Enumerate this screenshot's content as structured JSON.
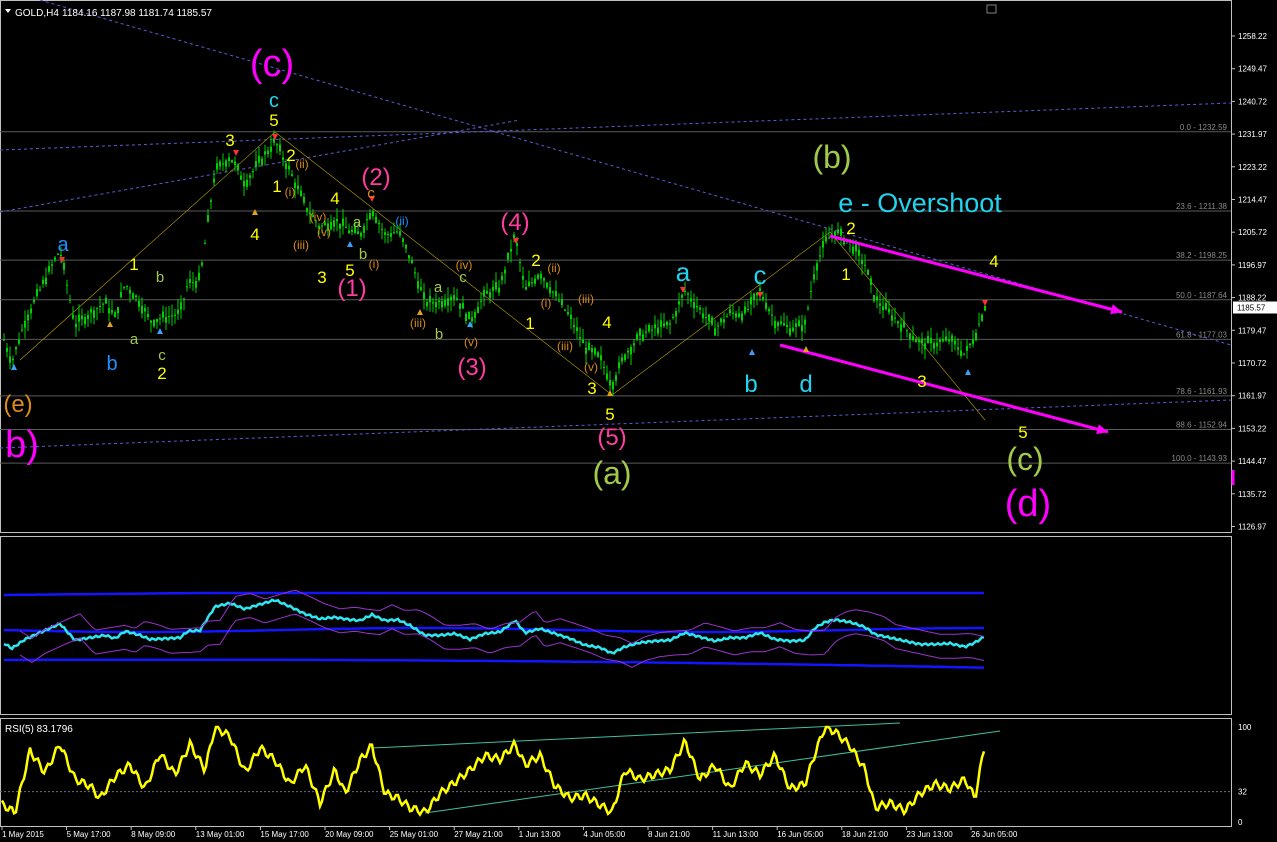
{
  "header": {
    "symbol": "GOLD,H4",
    "ohlc": "1184.16 1187.98 1181.74 1185.57"
  },
  "colors": {
    "candle": "#00d000",
    "magenta": "#ff00ff",
    "cyan": "#22d3ee",
    "blue": "#1e90ff",
    "yellow": "#ffff00",
    "olive": "#a3c94a",
    "orange": "#d98a1c",
    "red": "#ff2a2a",
    "pink": "#ff3ca0",
    "fib": "#8a8a8a",
    "channel": "#1414ff"
  },
  "chart_data": [
    {
      "type": "line",
      "panel": "price",
      "title": "",
      "ylim": [
        1122,
        1265
      ],
      "y_ticks": [
        "1258.22",
        "1249.47",
        "1240.72",
        "1231.97",
        "1223.22",
        "1214.47",
        "1205.72",
        "1196.97",
        "1188.22",
        "1179.47",
        "1170.72",
        "1161.97",
        "1153.22",
        "1144.47",
        "1135.72",
        "1126.97"
      ],
      "current_price": "1185.57",
      "x_ticks": [
        "1 May 2015",
        "5 May 17:00",
        "8 May 09:00",
        "13 May 01:00",
        "15 May 17:00",
        "20 May 09:00",
        "25 May 01:00",
        "27 May 21:00",
        "1 Jun 13:00",
        "4 Jun 05:00",
        "8 Jun 21:00",
        "11 Jun 13:00",
        "16 Jun 05:00",
        "18 Jun 21:00",
        "23 Jun 13:00",
        "26 Jun 05:00"
      ],
      "close_anchors": [
        [
          0,
          1180
        ],
        [
          12,
          1171
        ],
        [
          25,
          1182
        ],
        [
          45,
          1193
        ],
        [
          60,
          1201
        ],
        [
          75,
          1181
        ],
        [
          90,
          1184
        ],
        [
          105,
          1187
        ],
        [
          115,
          1183
        ],
        [
          125,
          1192
        ],
        [
          140,
          1187
        ],
        [
          150,
          1182
        ],
        [
          165,
          1183
        ],
        [
          180,
          1184
        ],
        [
          188,
          1192
        ],
        [
          200,
          1193
        ],
        [
          215,
          1222
        ],
        [
          230,
          1226
        ],
        [
          245,
          1219
        ],
        [
          258,
          1224
        ],
        [
          275,
          1230
        ],
        [
          290,
          1222
        ],
        [
          305,
          1213
        ],
        [
          320,
          1207
        ],
        [
          335,
          1209
        ],
        [
          350,
          1206
        ],
        [
          360,
          1205
        ],
        [
          372,
          1212
        ],
        [
          385,
          1205
        ],
        [
          398,
          1206
        ],
        [
          410,
          1199
        ],
        [
          425,
          1187
        ],
        [
          440,
          1187
        ],
        [
          455,
          1189
        ],
        [
          470,
          1182
        ],
        [
          485,
          1189
        ],
        [
          500,
          1191
        ],
        [
          515,
          1205
        ],
        [
          525,
          1190
        ],
        [
          540,
          1195
        ],
        [
          555,
          1189
        ],
        [
          570,
          1183
        ],
        [
          585,
          1175
        ],
        [
          600,
          1172
        ],
        [
          612,
          1165
        ],
        [
          625,
          1173
        ],
        [
          640,
          1178
        ],
        [
          655,
          1180
        ],
        [
          670,
          1181
        ],
        [
          685,
          1190
        ],
        [
          700,
          1185
        ],
        [
          715,
          1180
        ],
        [
          730,
          1184
        ],
        [
          745,
          1184
        ],
        [
          760,
          1190
        ],
        [
          775,
          1182
        ],
        [
          790,
          1180
        ],
        [
          805,
          1181
        ],
        [
          815,
          1196
        ],
        [
          825,
          1203
        ],
        [
          835,
          1206
        ],
        [
          850,
          1203
        ],
        [
          865,
          1197
        ],
        [
          875,
          1188
        ],
        [
          890,
          1184
        ],
        [
          905,
          1180
        ],
        [
          920,
          1176
        ],
        [
          935,
          1176
        ],
        [
          950,
          1177
        ],
        [
          965,
          1173
        ],
        [
          975,
          1178
        ],
        [
          985,
          1186
        ]
      ],
      "fibonacci": [
        {
          "level": "0.0",
          "price": 1232.59
        },
        {
          "level": "23.6",
          "price": 1211.38
        },
        {
          "level": "38.2",
          "price": 1198.25
        },
        {
          "level": "50.0",
          "price": 1187.64
        },
        {
          "level": "61.8",
          "price": 1177.03
        },
        {
          "level": "78.6",
          "price": 1161.93
        },
        {
          "level": "88.6",
          "price": 1152.94
        },
        {
          "level": "100.0",
          "price": 1143.93
        }
      ],
      "annotations": [
        {
          "text": "(c)",
          "color": "magenta",
          "size": 38,
          "x": 272,
          "y": 76
        },
        {
          "text": "c",
          "color": "cyan",
          "size": 20,
          "x": 274,
          "y": 107
        },
        {
          "text": "5",
          "color": "yellow",
          "size": 17,
          "x": 274,
          "y": 126
        },
        {
          "text": "3",
          "color": "yellow",
          "size": 17,
          "x": 230,
          "y": 146
        },
        {
          "text": "2",
          "color": "yellow",
          "size": 17,
          "x": 291,
          "y": 161
        },
        {
          "text": "1",
          "color": "yellow",
          "size": 17,
          "x": 277,
          "y": 192
        },
        {
          "text": "(ii)",
          "color": "orange",
          "size": 12,
          "x": 302,
          "y": 168
        },
        {
          "text": "(i)",
          "color": "orange",
          "size": 12,
          "x": 290,
          "y": 196
        },
        {
          "text": "4",
          "color": "yellow",
          "size": 17,
          "x": 255,
          "y": 240
        },
        {
          "text": "4",
          "color": "yellow",
          "size": 17,
          "x": 335,
          "y": 204
        },
        {
          "text": "(iv)",
          "color": "orange",
          "size": 12,
          "x": 318,
          "y": 221
        },
        {
          "text": "(v)",
          "color": "orange",
          "size": 12,
          "x": 324,
          "y": 236
        },
        {
          "text": "(iii)",
          "color": "orange",
          "size": 12,
          "x": 301,
          "y": 249
        },
        {
          "text": "3",
          "color": "yellow",
          "size": 17,
          "x": 322,
          "y": 283
        },
        {
          "text": "5",
          "color": "yellow",
          "size": 17,
          "x": 350,
          "y": 276
        },
        {
          "text": "a",
          "color": "olive",
          "size": 15,
          "x": 357,
          "y": 227
        },
        {
          "text": "b",
          "color": "olive",
          "size": 15,
          "x": 363,
          "y": 259
        },
        {
          "text": "c",
          "color": "orange",
          "size": 15,
          "x": 371,
          "y": 198
        },
        {
          "text": "(2)",
          "color": "pink",
          "size": 24,
          "x": 376,
          "y": 185
        },
        {
          "text": "(1)",
          "color": "pink",
          "size": 24,
          "x": 352,
          "y": 296
        },
        {
          "text": "(i)",
          "color": "orange",
          "size": 12,
          "x": 374,
          "y": 268
        },
        {
          "text": "(ii)",
          "color": "blue",
          "size": 12,
          "x": 402,
          "y": 225
        },
        {
          "text": "a",
          "color": "olive",
          "size": 15,
          "x": 438,
          "y": 292
        },
        {
          "text": "c",
          "color": "olive",
          "size": 15,
          "x": 463,
          "y": 282
        },
        {
          "text": "(iv)",
          "color": "orange",
          "size": 12,
          "x": 464,
          "y": 269
        },
        {
          "text": "b",
          "color": "olive",
          "size": 15,
          "x": 439,
          "y": 339
        },
        {
          "text": "(iii)",
          "color": "orange",
          "size": 12,
          "x": 418,
          "y": 327
        },
        {
          "text": "(v)",
          "color": "orange",
          "size": 12,
          "x": 471,
          "y": 346
        },
        {
          "text": "(3)",
          "color": "pink",
          "size": 24,
          "x": 472,
          "y": 375
        },
        {
          "text": "(4)",
          "color": "pink",
          "size": 24,
          "x": 515,
          "y": 230
        },
        {
          "text": "2",
          "color": "yellow",
          "size": 17,
          "x": 536,
          "y": 266
        },
        {
          "text": "(ii)",
          "color": "orange",
          "size": 12,
          "x": 554,
          "y": 272
        },
        {
          "text": "(i)",
          "color": "orange",
          "size": 12,
          "x": 546,
          "y": 307
        },
        {
          "text": "(iii)",
          "color": "orange",
          "size": 12,
          "x": 586,
          "y": 303
        },
        {
          "text": "1",
          "color": "yellow",
          "size": 17,
          "x": 530,
          "y": 329
        },
        {
          "text": "4",
          "color": "yellow",
          "size": 17,
          "x": 607,
          "y": 328
        },
        {
          "text": "(iii)",
          "color": "orange",
          "size": 12,
          "x": 565,
          "y": 350
        },
        {
          "text": "(v)",
          "color": "orange",
          "size": 12,
          "x": 591,
          "y": 371
        },
        {
          "text": "3",
          "color": "yellow",
          "size": 17,
          "x": 592,
          "y": 394
        },
        {
          "text": "5",
          "color": "yellow",
          "size": 17,
          "x": 610,
          "y": 420
        },
        {
          "text": "(5)",
          "color": "pink",
          "size": 24,
          "x": 612,
          "y": 445
        },
        {
          "text": "(a)",
          "color": "olive",
          "size": 32,
          "x": 612,
          "y": 484
        },
        {
          "text": "a",
          "color": "cyan",
          "size": 26,
          "x": 683,
          "y": 281
        },
        {
          "text": "c",
          "color": "cyan",
          "size": 26,
          "x": 760,
          "y": 284
        },
        {
          "text": "b",
          "color": "cyan",
          "size": 24,
          "x": 751,
          "y": 392
        },
        {
          "text": "d",
          "color": "cyan",
          "size": 24,
          "x": 806,
          "y": 392
        },
        {
          "text": "(b)",
          "color": "olive",
          "size": 32,
          "x": 832,
          "y": 168
        },
        {
          "text": "e - Overshoot",
          "color": "cyan",
          "size": 27,
          "x": 920,
          "y": 212
        },
        {
          "text": "2",
          "color": "yellow",
          "size": 17,
          "x": 851,
          "y": 234
        },
        {
          "text": "1",
          "color": "yellow",
          "size": 17,
          "x": 846,
          "y": 280
        },
        {
          "text": "4",
          "color": "yellow",
          "size": 17,
          "x": 994,
          "y": 267
        },
        {
          "text": "3",
          "color": "yellow",
          "size": 17,
          "x": 922,
          "y": 387
        },
        {
          "text": "5",
          "color": "yellow",
          "size": 17,
          "x": 1023,
          "y": 438
        },
        {
          "text": "(c)",
          "color": "olive",
          "size": 32,
          "x": 1025,
          "y": 470
        },
        {
          "text": "(d)",
          "color": "magenta",
          "size": 38,
          "x": 1028,
          "y": 516
        },
        {
          "text": "a",
          "color": "blue",
          "size": 20,
          "x": 63,
          "y": 251
        },
        {
          "text": "1",
          "color": "yellow",
          "size": 17,
          "x": 134,
          "y": 270
        },
        {
          "text": "b",
          "color": "olive",
          "size": 15,
          "x": 160,
          "y": 282
        },
        {
          "text": "b",
          "color": "blue",
          "size": 20,
          "x": 112,
          "y": 370
        },
        {
          "text": "a",
          "color": "olive",
          "size": 15,
          "x": 134,
          "y": 344
        },
        {
          "text": "c",
          "color": "olive",
          "size": 15,
          "x": 162,
          "y": 360
        },
        {
          "text": "2",
          "color": "yellow",
          "size": 17,
          "x": 162,
          "y": 379
        },
        {
          "text": "(e)",
          "color": "orange",
          "size": 24,
          "x": 18,
          "y": 412
        },
        {
          "text": "b)",
          "color": "magenta",
          "size": 38,
          "x": 22,
          "y": 457
        }
      ]
    },
    {
      "type": "line",
      "panel": "channel-indicator",
      "series": []
    },
    {
      "type": "line",
      "panel": "rsi",
      "title": "RSI(5) 83.1796",
      "ylim": [
        0,
        100
      ],
      "y_ticks": [
        "100",
        "32",
        "0"
      ],
      "levels": [
        32
      ],
      "values_anchors": [
        [
          0,
          20
        ],
        [
          15,
          10
        ],
        [
          30,
          75
        ],
        [
          45,
          52
        ],
        [
          60,
          82
        ],
        [
          75,
          45
        ],
        [
          90,
          38
        ],
        [
          100,
          25
        ],
        [
          115,
          48
        ],
        [
          130,
          60
        ],
        [
          145,
          35
        ],
        [
          160,
          72
        ],
        [
          175,
          50
        ],
        [
          190,
          82
        ],
        [
          205,
          55
        ],
        [
          215,
          100
        ],
        [
          230,
          90
        ],
        [
          245,
          52
        ],
        [
          260,
          78
        ],
        [
          275,
          65
        ],
        [
          290,
          40
        ],
        [
          305,
          60
        ],
        [
          320,
          20
        ],
        [
          335,
          55
        ],
        [
          345,
          30
        ],
        [
          360,
          65
        ],
        [
          372,
          80
        ],
        [
          385,
          30
        ],
        [
          398,
          25
        ],
        [
          410,
          15
        ],
        [
          425,
          10
        ],
        [
          440,
          30
        ],
        [
          455,
          42
        ],
        [
          470,
          55
        ],
        [
          485,
          70
        ],
        [
          500,
          66
        ],
        [
          515,
          82
        ],
        [
          525,
          60
        ],
        [
          540,
          70
        ],
        [
          555,
          38
        ],
        [
          570,
          25
        ],
        [
          585,
          28
        ],
        [
          600,
          18
        ],
        [
          612,
          10
        ],
        [
          625,
          55
        ],
        [
          640,
          45
        ],
        [
          655,
          50
        ],
        [
          670,
          55
        ],
        [
          685,
          85
        ],
        [
          700,
          45
        ],
        [
          715,
          60
        ],
        [
          730,
          35
        ],
        [
          745,
          62
        ],
        [
          760,
          50
        ],
        [
          775,
          70
        ],
        [
          790,
          35
        ],
        [
          805,
          40
        ],
        [
          815,
          72
        ],
        [
          825,
          100
        ],
        [
          835,
          95
        ],
        [
          850,
          80
        ],
        [
          865,
          55
        ],
        [
          875,
          15
        ],
        [
          890,
          20
        ],
        [
          905,
          12
        ],
        [
          920,
          30
        ],
        [
          935,
          40
        ],
        [
          950,
          35
        ],
        [
          965,
          45
        ],
        [
          975,
          25
        ],
        [
          985,
          83
        ]
      ]
    }
  ]
}
